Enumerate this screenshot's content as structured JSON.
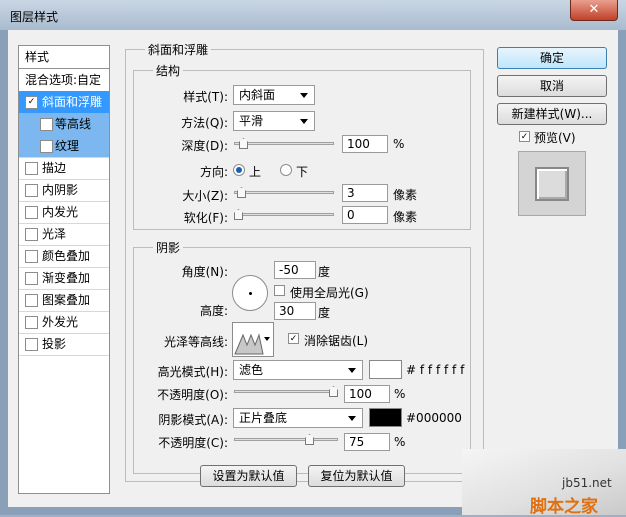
{
  "window": {
    "title": "图层样式",
    "close_glyph": "✕"
  },
  "sidebar": {
    "header": "样式",
    "blend_options": "混合选项:自定",
    "items": [
      {
        "label": "斜面和浮雕",
        "checked": true
      },
      {
        "label": "等高线",
        "checked": false
      },
      {
        "label": "纹理",
        "checked": false
      },
      {
        "label": "描边",
        "checked": false
      },
      {
        "label": "内阴影",
        "checked": false
      },
      {
        "label": "内发光",
        "checked": false
      },
      {
        "label": "光泽",
        "checked": false
      },
      {
        "label": "颜色叠加",
        "checked": false
      },
      {
        "label": "渐变叠加",
        "checked": false
      },
      {
        "label": "图案叠加",
        "checked": false
      },
      {
        "label": "外发光",
        "checked": false
      },
      {
        "label": "投影",
        "checked": false
      }
    ]
  },
  "bevel": {
    "group_title": "斜面和浮雕",
    "structure": {
      "title": "结构",
      "style_label": "样式(T):",
      "style_value": "内斜面",
      "technique_label": "方法(Q):",
      "technique_value": "平滑",
      "depth_label": "深度(D):",
      "depth_value": "100",
      "depth_unit": "%",
      "depth_level": 0.05,
      "direction_label": "方向:",
      "direction_up": "上",
      "direction_down": "下",
      "size_label": "大小(Z):",
      "size_value": "3",
      "size_unit": "像素",
      "size_level": 0.03,
      "soften_label": "软化(F):",
      "soften_value": "0",
      "soften_unit": "像素",
      "soften_level": 0.0
    },
    "shading": {
      "title": "阴影",
      "angle_label": "角度(N):",
      "angle_value": "-50",
      "angle_unit": "度",
      "global_light_label": "使用全局光(G)",
      "altitude_label": "高度:",
      "altitude_value": "30",
      "altitude_unit": "度",
      "gloss_label": "光泽等高线:",
      "antialias_label": "消除锯齿(L)",
      "antialias_checked": true,
      "highlight_mode_label": "高光模式(H):",
      "highlight_mode_value": "滤色",
      "highlight_color": "#ffffff",
      "highlight_hex_text": "# f f f f f f",
      "highlight_opacity_label": "不透明度(O):",
      "highlight_opacity_value": "100",
      "highlight_opacity_unit": "%",
      "highlight_opacity_level": 1.0,
      "shadow_mode_label": "阴影模式(A):",
      "shadow_mode_value": "正片叠底",
      "shadow_color": "#000000",
      "shadow_hex_text": "#000000",
      "shadow_opacity_label": "不透明度(C):",
      "shadow_opacity_value": "75",
      "shadow_opacity_unit": "%",
      "shadow_opacity_level": 0.75
    },
    "make_default": "设置为默认值",
    "reset_default": "复位为默认值"
  },
  "actions": {
    "ok": "确定",
    "cancel": "取消",
    "new_style": "新建样式(W)...",
    "preview_label": "预览(V)"
  },
  "watermark": {
    "site": "jb51.net",
    "name": "脚本之家"
  }
}
